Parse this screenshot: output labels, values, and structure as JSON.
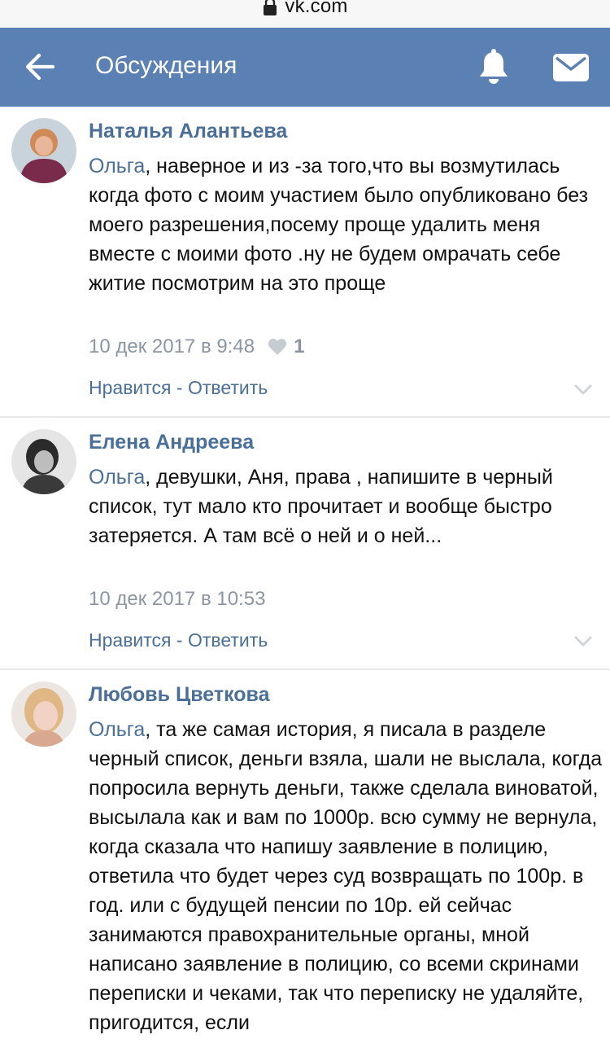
{
  "browser": {
    "url": "vk.com"
  },
  "header": {
    "title": "Обсуждения"
  },
  "comments": [
    {
      "author": "Наталья Алантьева",
      "mention": "Ольга",
      "text": ", наверное и из -за того,что вы возмутилась когда фото с моим участием было опубликовано без моего разрешения,посему проще удалить меня вместе с моими фото .ну не будем омрачать себе житие посмотрим на это проще",
      "date": "10 дек 2017 в 9:48",
      "likes": "1",
      "like_label": "Нравится",
      "separator": " - ",
      "reply_label": "Ответить"
    },
    {
      "author": "Елена Андреева",
      "mention": "Ольга",
      "text": ", девушки, Аня, права , напишите в черный список, тут мало кто прочитает и вообще быстро затеряется. А там всё о ней и о ней...",
      "date": "10 дек 2017 в 10:53",
      "like_label": "Нравится",
      "separator": " - ",
      "reply_label": "Ответить"
    },
    {
      "author": "Любовь Цветкова",
      "mention": "Ольга",
      "text": ", та же самая история, я писала в разделе черный список, деньги взяла, шали не выслала, когда попросила вернуть деньги, также сделала виноватой, высылала как и вам по 1000р. всю сумму не вернула, когда сказала что напишу заявление в полицию, ответила что будет через суд возвращать по 100р. в год. или с будущей пенсии по 10р. ей сейчас занимаются правохранительные органы, мной написано заявление в полицию, со всеми скринами переписки и чеками, так что переписку не удаляйте, пригодится, если"
    }
  ],
  "icons": {
    "back": "arrow-left-icon",
    "bell": "bell-icon",
    "mail": "envelope-icon",
    "heart": "heart-icon",
    "chevron": "chevron-down-icon",
    "lock": "lock-icon"
  },
  "colors": {
    "header_bg": "#5b80b4",
    "link": "#4a6f99",
    "meta": "#8c96a3"
  }
}
